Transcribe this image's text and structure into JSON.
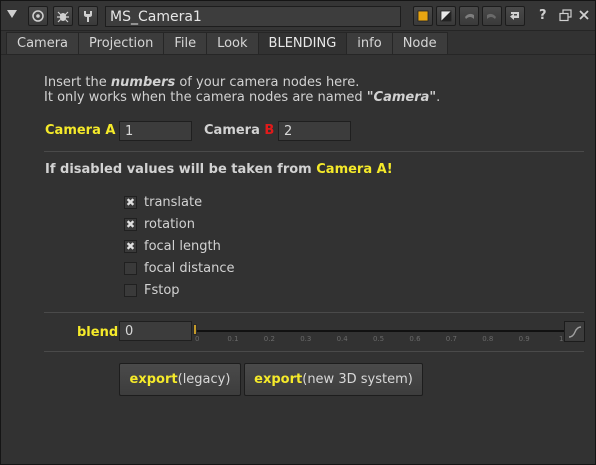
{
  "titlebar": {
    "node_name": "MS_Camera1",
    "help_label": "?",
    "icons": [
      "collapse-arrow-icon",
      "viewer-icon",
      "bug-icon",
      "wrench-icon",
      "color-swatch-icon",
      "diagonal-swatch-icon",
      "undo-icon",
      "redo-icon",
      "revert-icon",
      "help-icon",
      "float-icon",
      "close-icon"
    ]
  },
  "tabs": [
    {
      "label": "Camera"
    },
    {
      "label": "Projection"
    },
    {
      "label": "File"
    },
    {
      "label": "Look"
    },
    {
      "label": "BLENDING",
      "active": true
    },
    {
      "label": "info"
    },
    {
      "label": "Node"
    }
  ],
  "intro": {
    "line1_a": "Insert the ",
    "line1_b": "numbers",
    "line1_c": " of your camera nodes here.",
    "line2_a": "It only works when the camera nodes are named ",
    "line2_b": "\"Camera\"",
    "line2_c": "."
  },
  "camera_a": {
    "label": "Camera A",
    "value": "1"
  },
  "camera_b": {
    "label_prefix": "Camera ",
    "label_letter": "B",
    "value": "2"
  },
  "disabled_note": {
    "text": "If disabled values will be taken from ",
    "highlight": "Camera A!"
  },
  "checkboxes": [
    {
      "label": "translate",
      "checked": true,
      "mark": "✖"
    },
    {
      "label": "rotation",
      "checked": true,
      "mark": "✖"
    },
    {
      "label": "focal length",
      "checked": true,
      "mark": "✖"
    },
    {
      "label": "focal distance",
      "checked": false,
      "mark": ""
    },
    {
      "label": "Fstop",
      "checked": false,
      "mark": ""
    }
  ],
  "blend": {
    "label": "blend",
    "value": "0",
    "level": 0,
    "ticks": [
      "0",
      "0.1",
      "0.2",
      "0.3",
      "0.4",
      "0.5",
      "0.6",
      "0.7",
      "0.8",
      "0.9",
      "1"
    ]
  },
  "buttons": {
    "export_legacy": {
      "bold": "export",
      "rest": " (legacy)"
    },
    "export_new": {
      "bold": "export",
      "rest": " (new 3D system)"
    }
  },
  "colors": {
    "accent_yellow": "#f5ea2a",
    "accent_red": "#e11a1a",
    "slider_handle": "#c39a2a"
  }
}
